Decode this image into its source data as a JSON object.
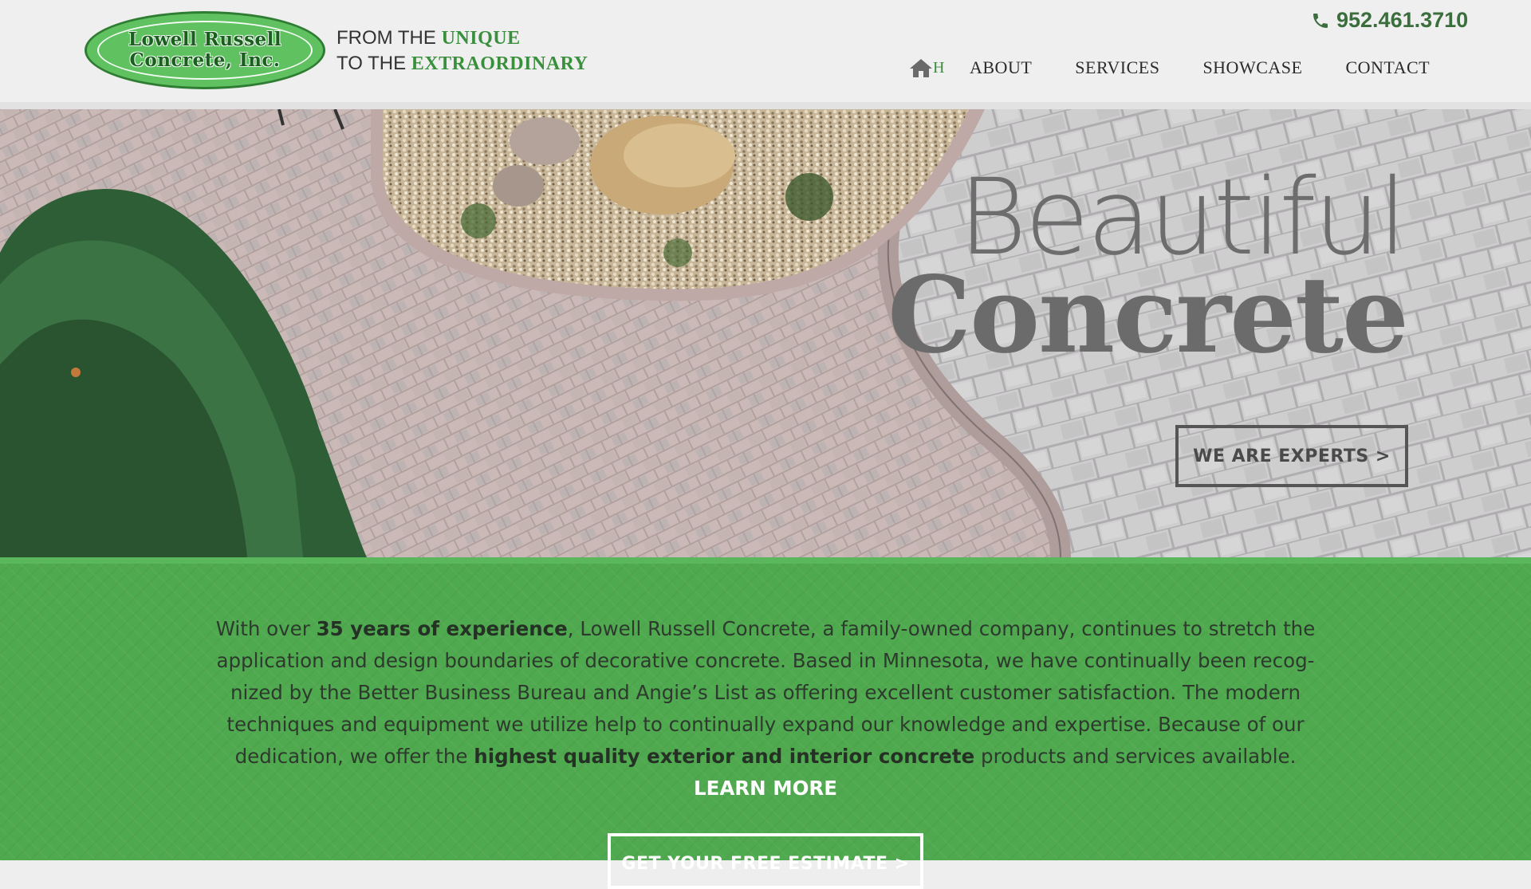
{
  "header": {
    "logo": {
      "line1": "Lowell Russell",
      "line2": "Concrete, Inc."
    },
    "tagline": {
      "line1_prefix": "FROM THE ",
      "line1_accent": "UNIQUE",
      "line2_prefix": "TO THE ",
      "line2_accent": "EXTRAORDINARY"
    },
    "phone": "952.461.3710",
    "nav": {
      "home_fragment": "H",
      "items": [
        "ABOUT",
        "SERVICES",
        "SHOWCASE",
        "CONTACT"
      ]
    }
  },
  "hero": {
    "title_line1": "Beautiful",
    "title_line2": "Concrete",
    "cta_label": "WE ARE EXPERTS >"
  },
  "intro": {
    "p_1": "With over ",
    "p_2_bold": "35 years of experience",
    "p_3": ", Lowell Russell Concrete, a family-owned company, continues to stretch the application and design boundaries of decorative concrete. Based in Minnesota,  we have continually been recog-nized by the Better Business Bureau and Angie’s List as offering excellent customer satisfaction. The modern techniques and equipment we utilize help to continually expand our knowledge and expertise. Because of our dedication, we offer the ",
    "p_4_bold": "highest quality exterior and interior concrete",
    "p_5": " products and services available. ",
    "learn_more": "LEARN MORE",
    "estimate_label": "GET YOUR FREE ESTIMATE >"
  },
  "colors": {
    "brand_green": "#4fa94f",
    "accent_green": "#3a8f3c",
    "header_bg": "#efefef"
  },
  "icons": [
    "phone-icon",
    "home-icon"
  ]
}
